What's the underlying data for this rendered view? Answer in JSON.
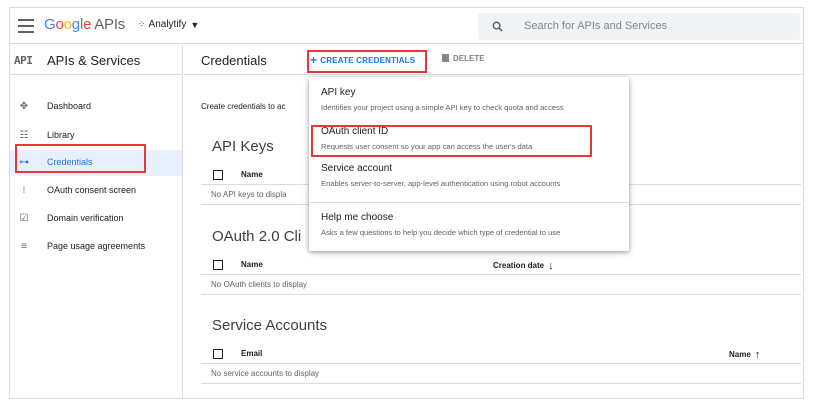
{
  "topbar": {
    "logo_parts": [
      "G",
      "o",
      "o",
      "g",
      "l",
      "e"
    ],
    "logo_suffix": "APIs",
    "project_name": "Analytify",
    "search_placeholder": "Search for APIs and Services"
  },
  "nav": {
    "badge": "API",
    "title": "APIs & Services",
    "items": [
      {
        "label": "Dashboard",
        "icon": "dashboard-icon",
        "glyph": "✥"
      },
      {
        "label": "Library",
        "icon": "library-icon",
        "glyph": "☷"
      },
      {
        "label": "Credentials",
        "icon": "key-icon",
        "glyph": "⊶"
      },
      {
        "label": "OAuth consent screen",
        "icon": "consent-icon",
        "glyph": "⁝"
      },
      {
        "label": "Domain verification",
        "icon": "domain-icon",
        "glyph": "☑"
      },
      {
        "label": "Page usage agreements",
        "icon": "settings-icon",
        "glyph": "≡"
      }
    ]
  },
  "main": {
    "title": "Credentials",
    "create_label": "CREATE CREDENTIALS",
    "delete_label": "DELETE",
    "intro": "Create credentials to ac",
    "api_keys": {
      "title": "API Keys",
      "col_name": "Name",
      "empty": "No API keys to displa"
    },
    "oauth": {
      "title": "OAuth 2.0 Cli",
      "col_name": "Name",
      "col_date": "Creation date",
      "empty": "No OAuth clients to display"
    },
    "service": {
      "title": "Service Accounts",
      "col_email": "Email",
      "col_name": "Name",
      "empty": "No service accounts to display"
    }
  },
  "dropdown": {
    "items": [
      {
        "title": "API key",
        "desc": "Identifies your project using a simple API key to check quota and access"
      },
      {
        "title": "OAuth client ID",
        "desc": "Requests user consent so your app can access the user's data"
      },
      {
        "title": "Service account",
        "desc": "Enables server-to-server, app-level authentication using robot accounts"
      },
      {
        "title": "Help me choose",
        "desc": "Asks a few questions to help you decide which type of credential to use"
      }
    ]
  },
  "colors": {
    "accent": "#1a73e8",
    "highlight_box": "#e53935",
    "active_bg": "#e8f0fe"
  }
}
